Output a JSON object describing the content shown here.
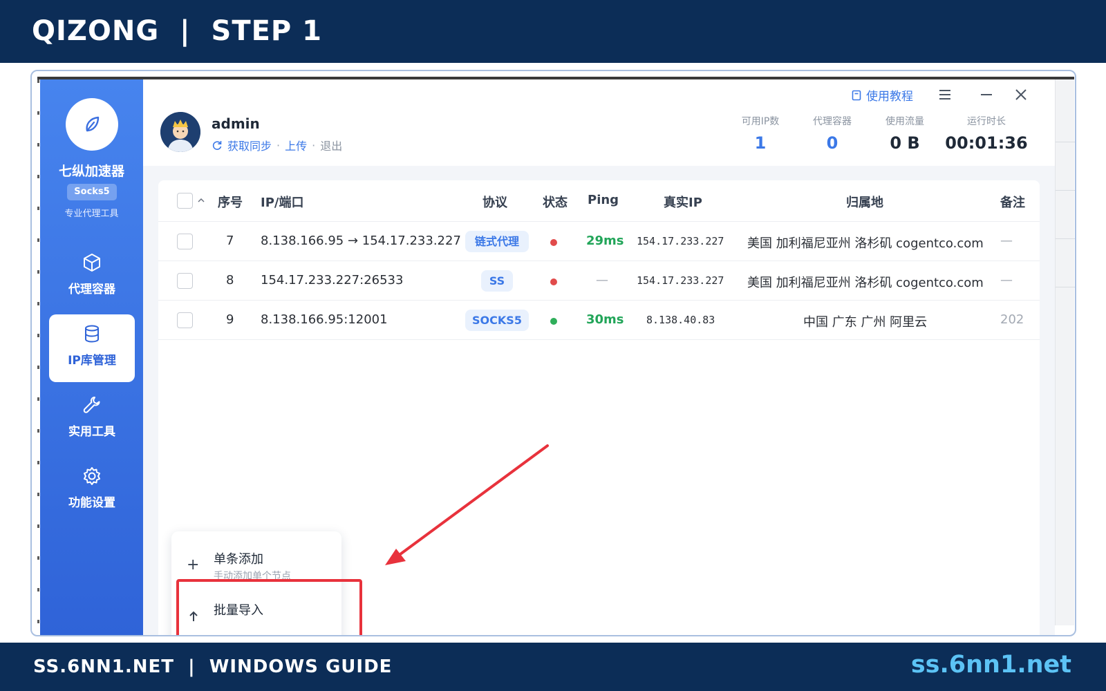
{
  "banner": {
    "title": "QIZONG  |  STEP 1"
  },
  "sidebar": {
    "app_name": "七纵加速器",
    "badge": "Socks5",
    "subtitle": "专业代理工具",
    "items": [
      {
        "label": "代理容器",
        "icon": "cube-icon",
        "active": false
      },
      {
        "label": "IP库管理",
        "icon": "database-icon",
        "active": true
      },
      {
        "label": "实用工具",
        "icon": "wrench-icon",
        "active": false
      },
      {
        "label": "功能设置",
        "icon": "gear-icon",
        "active": false
      }
    ]
  },
  "header": {
    "tutorial": "使用教程",
    "username": "admin",
    "actions": {
      "sync": "获取同步",
      "upload": "上传",
      "logout": "退出",
      "separator": "·"
    },
    "stats": [
      {
        "label": "可用IP数",
        "value": "1",
        "color": "#3b78e7"
      },
      {
        "label": "代理容器",
        "value": "0",
        "color": "#3b78e7"
      },
      {
        "label": "使用流量",
        "value": "0 B",
        "color": "#1f2937"
      },
      {
        "label": "运行时长",
        "value": "00:01:36",
        "color": "#1f2937"
      }
    ]
  },
  "table": {
    "columns": {
      "index": "序号",
      "ip": "IP/端口",
      "protocol": "协议",
      "status": "状态",
      "ping": "Ping",
      "real_ip": "真实IP",
      "location": "归属地",
      "note": "备注"
    },
    "rows": [
      {
        "index": "7",
        "ip": "8.138.166.95 → 154.17.233.227",
        "protocol": "链式代理",
        "status": "offline",
        "ping": "29ms",
        "real_ip": "154.17.233.227",
        "location": "美国 加利福尼亚州 洛杉矶 cogentco.com",
        "note": "—"
      },
      {
        "index": "8",
        "ip": "154.17.233.227:26533",
        "protocol": "SS",
        "status": "offline",
        "ping": "—",
        "real_ip": "154.17.233.227",
        "location": "美国 加利福尼亚州 洛杉矶 cogentco.com",
        "note": "—"
      },
      {
        "index": "9",
        "ip": "8.138.166.95:12001",
        "protocol": "SOCKS5",
        "status": "online",
        "ping": "30ms",
        "real_ip": "8.138.40.83",
        "location": "中国 广东 广州 阿里云",
        "note": "202"
      }
    ]
  },
  "popup_menu": {
    "items": [
      {
        "icon": "plus-icon",
        "title": "单条添加",
        "subtitle": "手动添加单个节点"
      },
      {
        "icon": "upload-icon",
        "title": "批量导入",
        "subtitle": ""
      }
    ]
  },
  "colors": {
    "accent": "#3b78e7",
    "banner": "#0c2d57",
    "status_offline": "#e14b4b",
    "status_online": "#2fae5a",
    "highlight": "#e8323c"
  },
  "footer": {
    "left": "SS.6NN1.NET  |  WINDOWS GUIDE",
    "right": "ss.6nn1.net"
  }
}
